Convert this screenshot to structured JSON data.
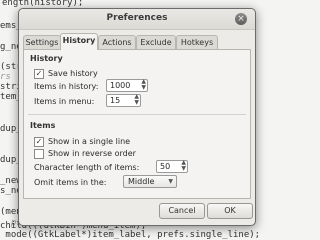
{
  "background_code": [
    {
      "text": "ength(history);  ",
      "style": "normal"
    },
    {
      "text": "ems_",
      "style": "normal"
    },
    {
      "text": "g_ne",
      "style": "normal"
    },
    {
      "text": "(str",
      "style": "normal"
    },
    {
      "text": "rs",
      "style": "gray"
    },
    {
      "text": "stri",
      "style": "normal"
    },
    {
      "text": "tem_",
      "style": "normal"
    },
    {
      "text": "dup_",
      "style": "normal"
    },
    {
      "text": "dup_",
      "style": "normal"
    },
    {
      "text": "_new",
      "style": "normal"
    },
    {
      "text": "s_ne",
      "style": "normal"
    },
    {
      "text": "(men",
      "style": "normal"
    },
    {
      "text": "child(((GtkBin*)menu_item);",
      "style": "normal"
    },
    {
      "text": " mode((GtkLabel*)item_label, prefs.single_line);",
      "style": "normal"
    },
    {
      "text": "  pro",
      "style": "gray"
    }
  ],
  "dialog": {
    "title": "Preferences",
    "close_glyph": "×",
    "tabs": [
      {
        "label": "Settings",
        "active": false
      },
      {
        "label": "History",
        "active": true
      },
      {
        "label": "Actions",
        "active": false
      },
      {
        "label": "Exclude",
        "active": false
      },
      {
        "label": "Hotkeys",
        "active": false
      }
    ],
    "history_section": {
      "title": "History",
      "save_history": {
        "label": "Save history",
        "checked": true
      },
      "items_in_history": {
        "label": "Items in history:",
        "value": "1000"
      },
      "items_in_menu": {
        "label": "Items in menu:",
        "value": "15"
      }
    },
    "items_section": {
      "title": "Items",
      "single_line": {
        "label": "Show in a single line",
        "checked": true
      },
      "reverse_order": {
        "label": "Show in reverse order",
        "checked": false
      },
      "char_length": {
        "label": "Character length of items:",
        "value": "50"
      },
      "omit_items": {
        "label": "Omit items in the:",
        "value": "Middle"
      }
    },
    "cancel_label": "Cancel",
    "ok_label": "OK"
  },
  "check_glyph": "✓",
  "spin_glyph": "▲▼",
  "combo_glyph": "▼"
}
